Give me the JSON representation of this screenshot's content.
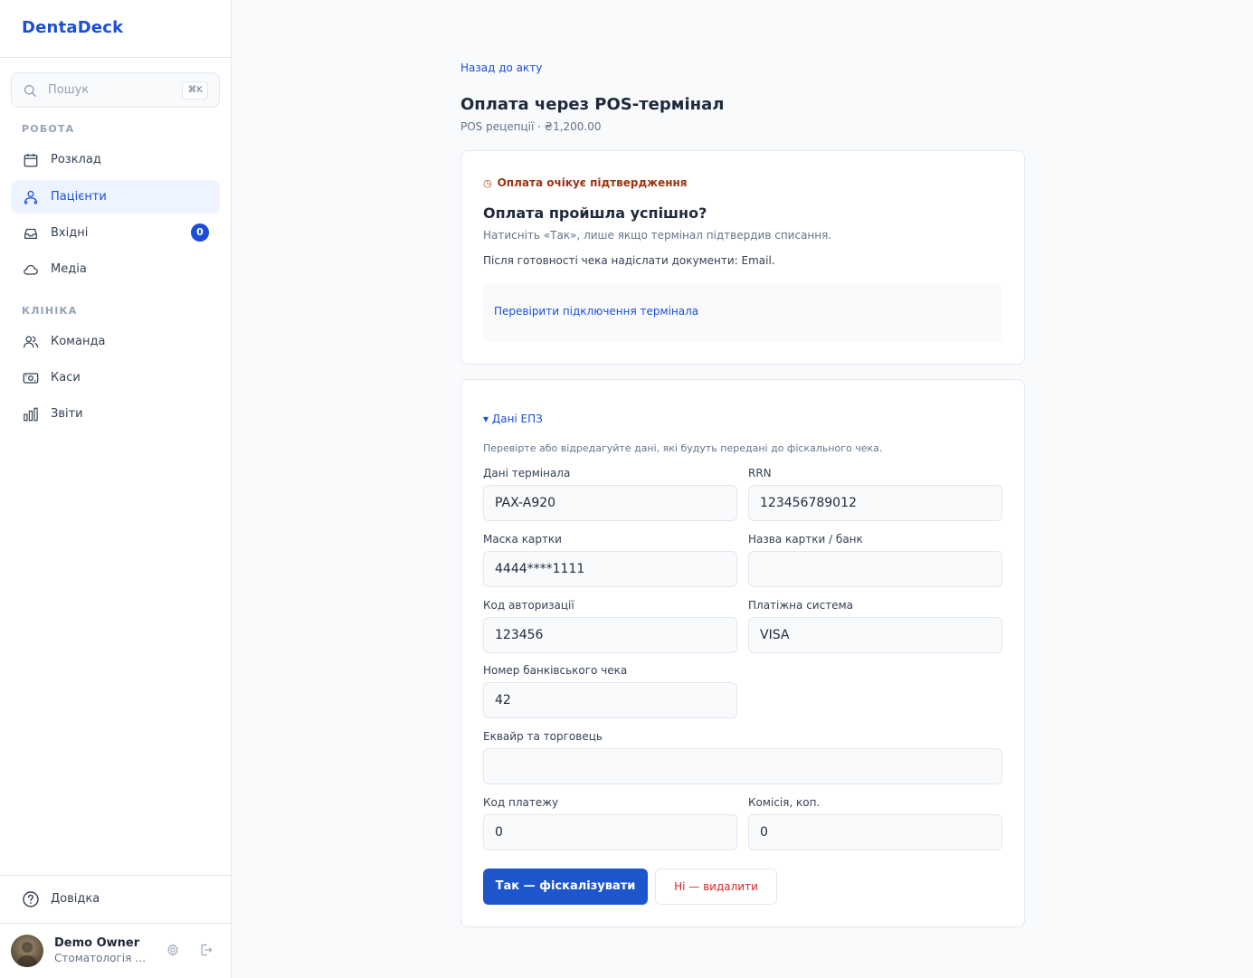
{
  "app": {
    "brand": "DentaDeck"
  },
  "search": {
    "placeholder": "Пошук",
    "shortcut": "⌘K",
    "icon": "search-icon"
  },
  "sidebar": {
    "sections": [
      {
        "label": "РОБОТА"
      },
      {
        "label": "КЛІНІКА"
      }
    ],
    "items": [
      {
        "label": "Розклад",
        "icon": "calendar-icon"
      },
      {
        "label": "Пацієнти",
        "icon": "patients-icon",
        "active": true
      },
      {
        "label": "Вхідні",
        "icon": "inbox-icon",
        "badge": "0"
      },
      {
        "label": "Медіа",
        "icon": "cloud-icon"
      },
      {
        "label": "Команда",
        "icon": "team-icon"
      },
      {
        "label": "Каси",
        "icon": "cash-register-icon"
      },
      {
        "label": "Звіти",
        "icon": "reports-icon"
      }
    ],
    "help": {
      "label": "Довідка",
      "icon": "help-icon"
    },
    "user": {
      "name": "Demo Owner",
      "org": "Стоматологія Приклад"
    }
  },
  "main": {
    "back_link": "Назад до акту",
    "title": "Оплата через POS-термінал",
    "subtitle": "POS рецепції · ₴1,200.00",
    "confirm_card": {
      "status_icon": "◷",
      "status": "Оплата очікує підтвердження",
      "question": "Оплата пройшла успішно?",
      "hint": "Натисніть «Так», лише якщо термінал підтвердив списання.",
      "docs": "Після готовності чека надіслати документи: Email.",
      "check_link": "Перевірити підключення термінала"
    },
    "epz_card": {
      "toggle": "▾ Дані ЕПЗ",
      "description": "Перевірте або відредагуйте дані, які будуть передані до фіскального чека.",
      "fields": {
        "terminal": {
          "label": "Дані термінала",
          "value": "PAX-A920"
        },
        "rrn": {
          "label": "RRN",
          "value": "123456789012"
        },
        "card_mask": {
          "label": "Маска картки",
          "value": "4444****1111"
        },
        "card_bank": {
          "label": "Назва картки / банк",
          "value": ""
        },
        "auth_code": {
          "label": "Код авторизації",
          "value": "123456"
        },
        "payment_system": {
          "label": "Платіжна система",
          "value": "VISA"
        },
        "receipt_no": {
          "label": "Номер банківського чека",
          "value": "42"
        },
        "acquirer": {
          "label": "Еквайр та торговець",
          "value": ""
        },
        "payment_code": {
          "label": "Код платежу",
          "value": "0"
        },
        "commission": {
          "label": "Комісія, коп.",
          "value": "0"
        }
      },
      "confirm_button": "Так — фіскалізувати",
      "reject_button": "Ні — видалити"
    }
  },
  "colors": {
    "accent": "#1d4ed8",
    "pending": "#9a3412",
    "danger": "#dc2626"
  }
}
